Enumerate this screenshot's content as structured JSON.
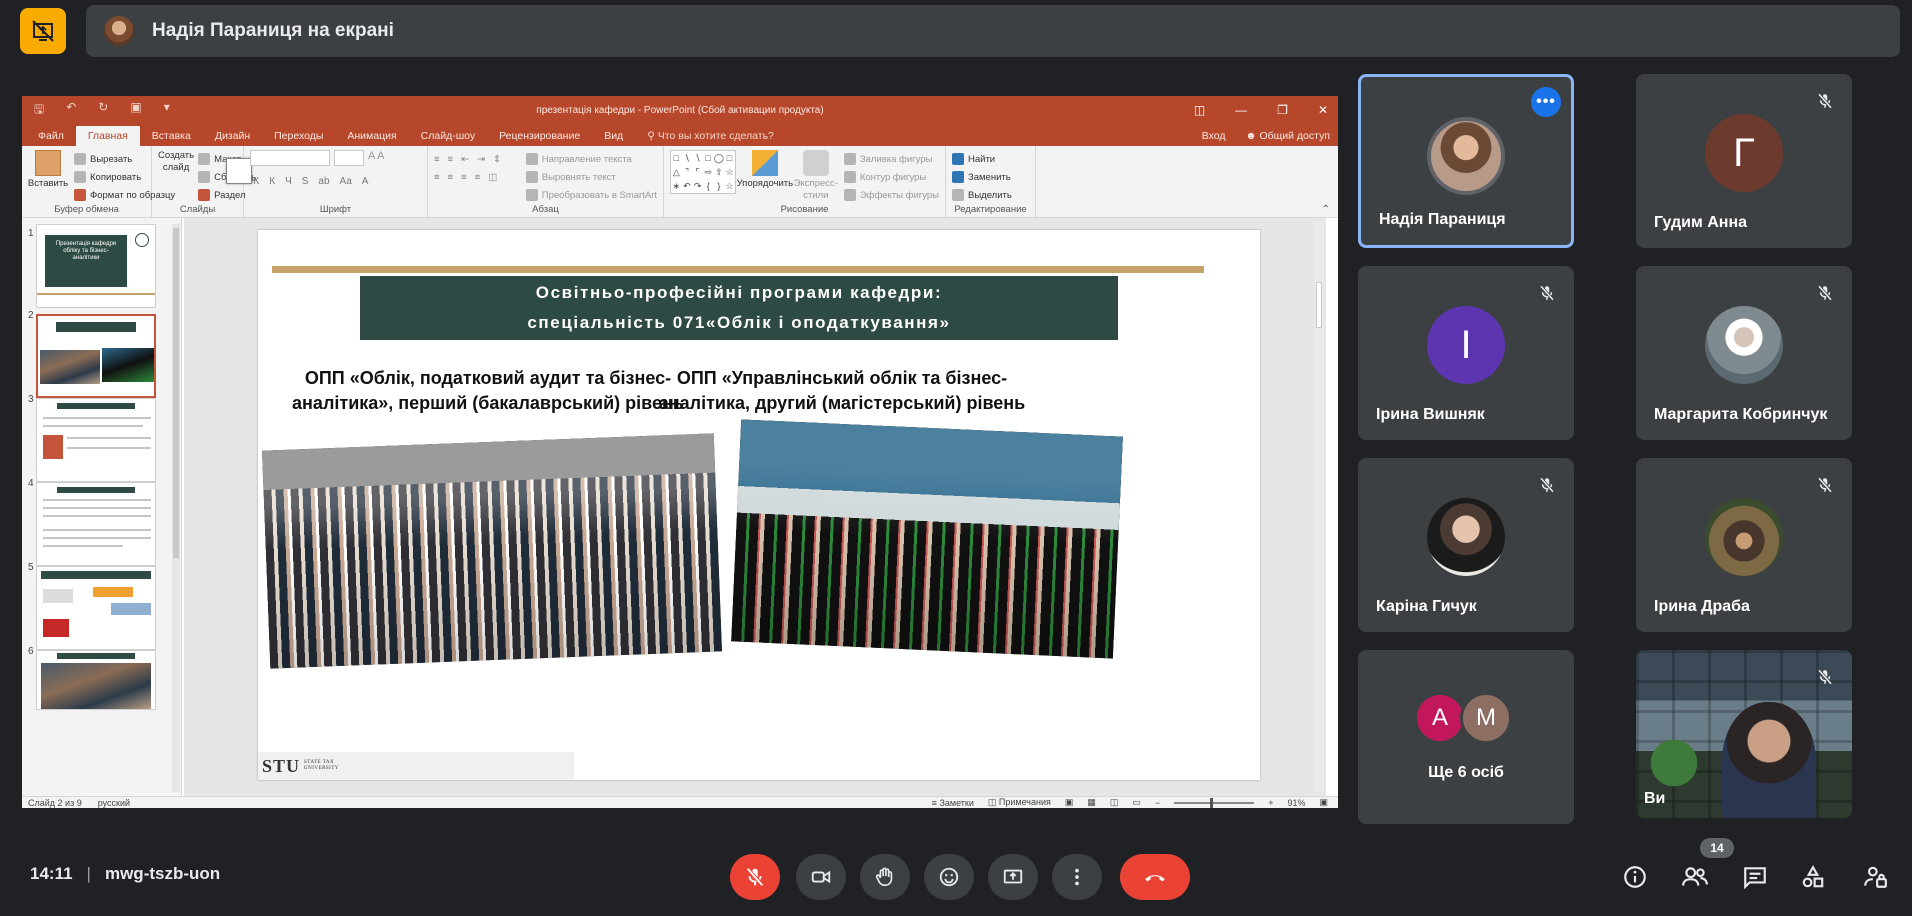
{
  "presenting": {
    "text": "Надія Параниця на екрані"
  },
  "ppt": {
    "window_title": "презентація кафедри - PowerPoint (Сбой активации продукта)",
    "tabs": [
      "Файл",
      "Главная",
      "Вставка",
      "Дизайн",
      "Переходы",
      "Анимация",
      "Слайд-шоу",
      "Рецензирование",
      "Вид"
    ],
    "tell_me": "Что вы хотите сделать?",
    "signin": "Вход",
    "share": "Общий доступ",
    "ribbon": {
      "clipboard": {
        "paste": "Вставить",
        "cut": "Вырезать",
        "copy": "Копировать",
        "format": "Формат по образцу",
        "label": "Буфер обмена"
      },
      "slides": {
        "create": "Создать слайд",
        "layout": "Макет",
        "reset": "Сбросить",
        "section": "Раздел",
        "label": "Слайды"
      },
      "font": {
        "label": "Шрифт"
      },
      "paragraph": {
        "direction": "Направление текста",
        "align": "Выровнять текст",
        "smartart": "Преобразовать в SmartArt",
        "label": "Абзац"
      },
      "drawing": {
        "arrange": "Упорядочить",
        "quick": "Экспресс-стили",
        "fill": "Заливка фигуры",
        "outline": "Контур фигуры",
        "effects": "Эффекты фигуры",
        "label": "Рисование"
      },
      "editing": {
        "find": "Найти",
        "replace": "Заменить",
        "select": "Выделить",
        "label": "Редактирование"
      }
    },
    "thumbnails": [
      "1",
      "2",
      "3",
      "4",
      "5",
      "6"
    ],
    "thumb1_title": "Презентація кафедри обліку та бізнес-аналітики",
    "status": {
      "slide": "Слайд 2 из 9",
      "lang": "русский",
      "notes": "Заметки",
      "comments": "Примечания",
      "zoom": "91%"
    }
  },
  "slide": {
    "title_line1": "Освітньо-професійні програми кафедри:",
    "title_line2": "спеціальність 071«Облік і оподаткування»",
    "prog_left": "ОПП «Облік, податковий аудит та бізнес-аналітика», перший (бакалаврський) рівень",
    "prog_right": "ОПП «Управлінський облік та бізнес-аналітика, другий (магістерський) рівень",
    "logo": "STU",
    "logo_sub": "STATE TAX UNIVERSITY"
  },
  "participants": [
    {
      "name": "Надія Параниця",
      "initial": ""
    },
    {
      "name": "Гудим Анна",
      "initial": "Г",
      "color": "#6d3a2e"
    },
    {
      "name": "Ірина Вишняк",
      "initial": "І",
      "color": "#5e35b1"
    },
    {
      "name": "Маргарита Кобринчук",
      "initial": ""
    },
    {
      "name": "Каріна Гичук",
      "initial": ""
    },
    {
      "name": "Ірина Драба",
      "initial": ""
    }
  ],
  "more_tile": {
    "a": "А",
    "m": "М",
    "label": "Ще 6 осіб"
  },
  "video_tile": {
    "label": "Ви"
  },
  "bottom": {
    "time": "14:11",
    "code": "mwg-tszb-uon",
    "people_count": "14"
  },
  "colors": {
    "accent_present": "#f9ab00",
    "ppt_brand": "#b7472a",
    "danger": "#ea4335",
    "slide_title_bg": "#2e4a44"
  }
}
